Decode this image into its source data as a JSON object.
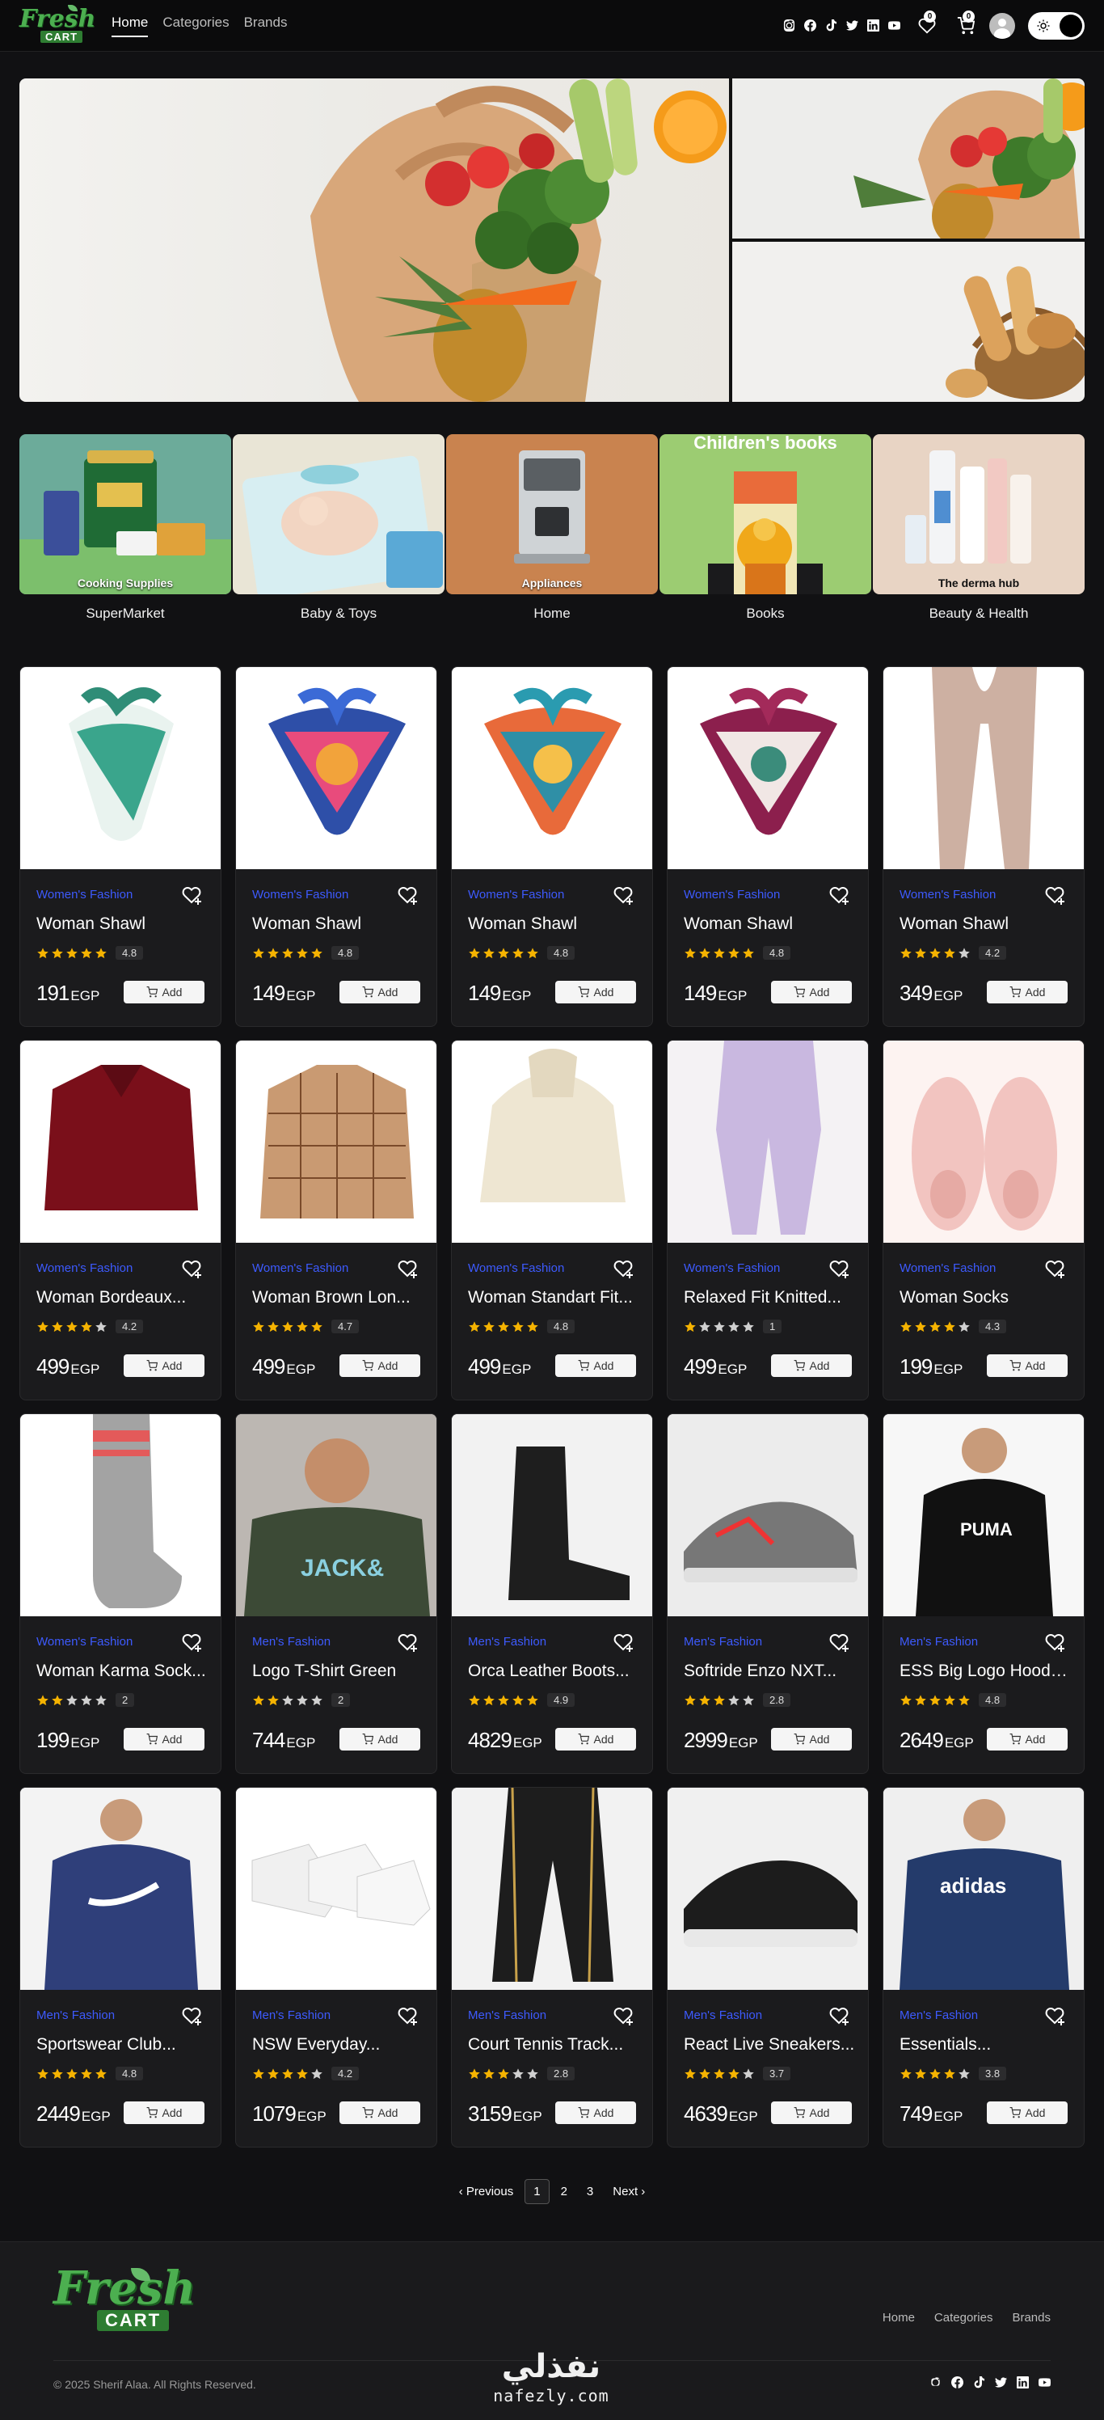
{
  "brand": {
    "line1": "Fresh",
    "line2": "CART"
  },
  "nav": {
    "links": [
      "Home",
      "Categories",
      "Brands"
    ],
    "active": "Home",
    "social_icons": [
      "instagram-icon",
      "facebook-icon",
      "tiktok-icon",
      "twitter-icon",
      "linkedin-icon",
      "youtube-icon"
    ],
    "wishlist_count": "0",
    "cart_count": "0"
  },
  "hero": {
    "slides": [
      "groceries-bag",
      "groceries-bag-small",
      "bread-basket"
    ]
  },
  "categories": [
    {
      "name": "SuperMarket",
      "caption": "Cooking Supplies"
    },
    {
      "name": "Baby & Toys",
      "caption": ""
    },
    {
      "name": "Home",
      "caption": "Appliances"
    },
    {
      "name": "Books",
      "caption": "Children's books"
    },
    {
      "name": "Beauty & Health",
      "caption": "The derma hub"
    }
  ],
  "products": [
    {
      "category": "Women's Fashion",
      "title": "Woman Shawl",
      "rating": "4.8",
      "stars": 5,
      "price": "191",
      "currency": "EGP",
      "add": "Add"
    },
    {
      "category": "Women's Fashion",
      "title": "Woman Shawl",
      "rating": "4.8",
      "stars": 5,
      "price": "149",
      "currency": "EGP",
      "add": "Add"
    },
    {
      "category": "Women's Fashion",
      "title": "Woman Shawl",
      "rating": "4.8",
      "stars": 5,
      "price": "149",
      "currency": "EGP",
      "add": "Add"
    },
    {
      "category": "Women's Fashion",
      "title": "Woman Shawl",
      "rating": "4.8",
      "stars": 5,
      "price": "149",
      "currency": "EGP",
      "add": "Add"
    },
    {
      "category": "Women's Fashion",
      "title": "Woman Shawl",
      "rating": "4.2",
      "stars": 4,
      "price": "349",
      "currency": "EGP",
      "add": "Add"
    },
    {
      "category": "Women's Fashion",
      "title": "Woman Bordeaux...",
      "rating": "4.2",
      "stars": 4,
      "price": "499",
      "currency": "EGP",
      "add": "Add"
    },
    {
      "category": "Women's Fashion",
      "title": "Woman Brown Lon...",
      "rating": "4.7",
      "stars": 5,
      "price": "499",
      "currency": "EGP",
      "add": "Add"
    },
    {
      "category": "Women's Fashion",
      "title": "Woman Standart Fit...",
      "rating": "4.8",
      "stars": 5,
      "price": "499",
      "currency": "EGP",
      "add": "Add"
    },
    {
      "category": "Women's Fashion",
      "title": "Relaxed Fit Knitted...",
      "rating": "1",
      "stars": 1,
      "price": "499",
      "currency": "EGP",
      "add": "Add"
    },
    {
      "category": "Women's Fashion",
      "title": "Woman Socks",
      "rating": "4.3",
      "stars": 4,
      "price": "199",
      "currency": "EGP",
      "add": "Add"
    },
    {
      "category": "Women's Fashion",
      "title": "Woman Karma Sock...",
      "rating": "2",
      "stars": 2,
      "price": "199",
      "currency": "EGP",
      "add": "Add"
    },
    {
      "category": "Men's Fashion",
      "title": "Logo T-Shirt Green",
      "rating": "2",
      "stars": 2,
      "price": "744",
      "currency": "EGP",
      "add": "Add"
    },
    {
      "category": "Men's Fashion",
      "title": "Orca Leather Boots...",
      "rating": "4.9",
      "stars": 5,
      "price": "4829",
      "currency": "EGP",
      "add": "Add"
    },
    {
      "category": "Men's Fashion",
      "title": "Softride Enzo NXT...",
      "rating": "2.8",
      "stars": 3,
      "price": "2999",
      "currency": "EGP",
      "add": "Add"
    },
    {
      "category": "Men's Fashion",
      "title": "ESS Big Logo Hoodie...",
      "rating": "4.8",
      "stars": 5,
      "price": "2649",
      "currency": "EGP",
      "add": "Add"
    },
    {
      "category": "Men's Fashion",
      "title": "Sportswear Club...",
      "rating": "4.8",
      "stars": 5,
      "price": "2449",
      "currency": "EGP",
      "add": "Add"
    },
    {
      "category": "Men's Fashion",
      "title": "NSW Everyday...",
      "rating": "4.2",
      "stars": 4,
      "price": "1079",
      "currency": "EGP",
      "add": "Add"
    },
    {
      "category": "Men's Fashion",
      "title": "Court Tennis Track...",
      "rating": "2.8",
      "stars": 3,
      "price": "3159",
      "currency": "EGP",
      "add": "Add"
    },
    {
      "category": "Men's Fashion",
      "title": "React Live Sneakers...",
      "rating": "3.7",
      "stars": 4,
      "price": "4639",
      "currency": "EGP",
      "add": "Add"
    },
    {
      "category": "Men's Fashion",
      "title": "Essentials...",
      "rating": "3.8",
      "stars": 4,
      "price": "749",
      "currency": "EGP",
      "add": "Add"
    }
  ],
  "pagination": {
    "previous": "Previous",
    "pages": [
      "1",
      "2",
      "3"
    ],
    "current": "1",
    "next": "Next"
  },
  "footer": {
    "links": [
      "Home",
      "Categories",
      "Brands"
    ],
    "copyright": "© 2025 Sherif Alaa. All Rights Reserved.",
    "watermark_ar": "نفذلي",
    "watermark_en": "nafezly.com"
  },
  "colors": {
    "accent": "#3d5afe",
    "star": "#f5b301",
    "bg": "#111113",
    "card": "#1b1b1d",
    "logo_green": "#4caf50"
  }
}
